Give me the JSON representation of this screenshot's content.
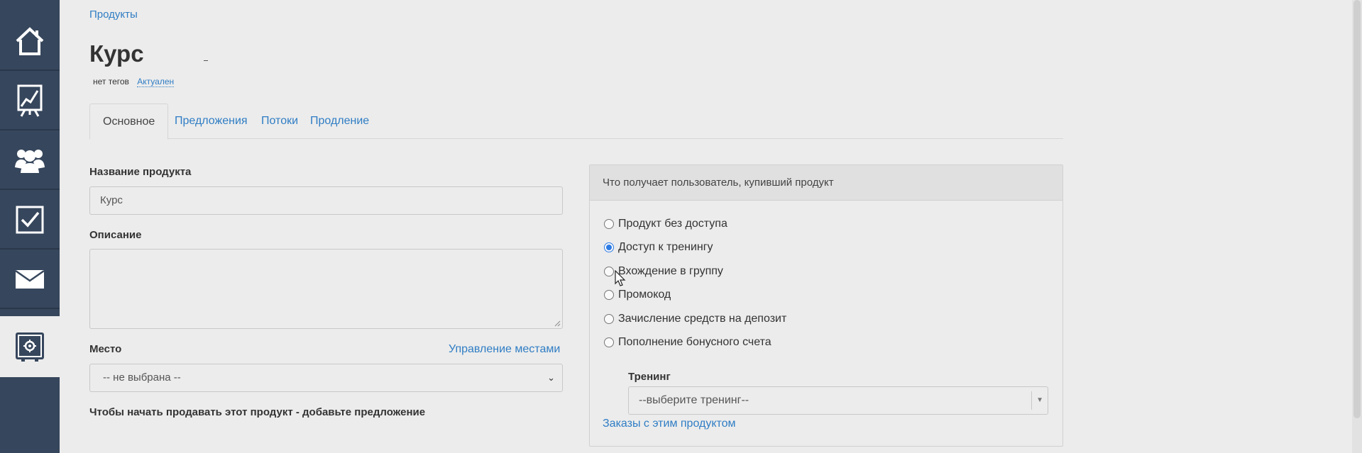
{
  "breadcrumb": "Продукты",
  "page": {
    "title": "Курс",
    "tags": "нет тегов",
    "status": "Актуален"
  },
  "tabs": [
    {
      "label": "Основное"
    },
    {
      "label": "Предложения"
    },
    {
      "label": "Потоки"
    },
    {
      "label": "Продление"
    }
  ],
  "form": {
    "name_label": "Название продукта",
    "name_value": "Курс",
    "description_label": "Описание",
    "description_value": "",
    "place_label": "Место",
    "manage_places_link": "Управление местами",
    "place_value": "-- не выбрана --",
    "hint": "Чтобы начать продавать этот продукт - добавьте предложение"
  },
  "panel": {
    "title": "Что получает пользователь, купивший продукт",
    "options": [
      {
        "label": "Продукт без доступа",
        "checked": false
      },
      {
        "label": "Доступ к тренингу",
        "checked": true
      },
      {
        "label": "Вхождение в группу",
        "checked": false
      },
      {
        "label": "Промокод",
        "checked": false
      },
      {
        "label": "Зачисление средств на депозит",
        "checked": false
      },
      {
        "label": "Пополнение бонусного счета",
        "checked": false
      }
    ],
    "training_label": "Тренинг",
    "training_value": "--выберите тренинг--",
    "orders_link": "Заказы с этим продуктом"
  },
  "sidebar": {
    "items": [
      {
        "icon": "home-icon"
      },
      {
        "icon": "chart-board-icon"
      },
      {
        "icon": "users-icon"
      },
      {
        "icon": "checkbox-icon"
      },
      {
        "icon": "envelope-icon"
      },
      {
        "icon": "safe-icon",
        "active": true
      }
    ]
  },
  "colors": {
    "sidebar": "#36465c",
    "link": "#2f7dc4",
    "background": "#ececec"
  }
}
